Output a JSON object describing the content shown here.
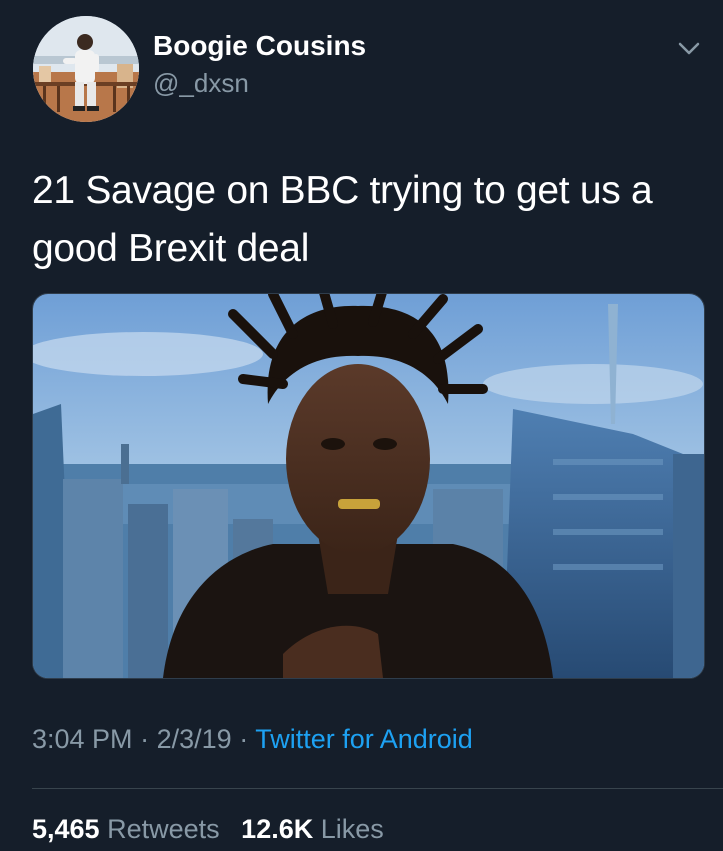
{
  "user": {
    "name": "Boogie Cousins",
    "handle": "@_dxsn"
  },
  "tweet": {
    "text": "21 Savage on BBC trying to get us a good Brexit deal"
  },
  "meta": {
    "time": "3:04 PM",
    "separator": "·",
    "date": "2/3/19",
    "source": "Twitter for Android"
  },
  "stats": {
    "retweets_count": "5,465",
    "retweets_label": "Retweets",
    "likes_count": "12.6K",
    "likes_label": "Likes"
  },
  "icons": {
    "menu": "chevron-down-icon"
  },
  "colors": {
    "background": "#151e2a",
    "primary_text": "#ffffff",
    "secondary_text": "#8899a6",
    "link": "#1da1f2",
    "divider": "#38444d"
  }
}
